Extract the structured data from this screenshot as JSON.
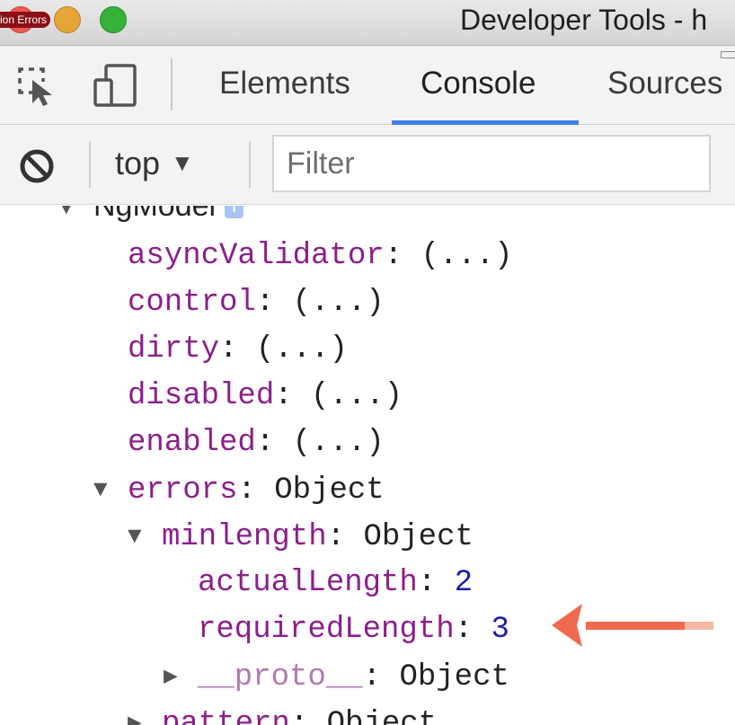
{
  "window": {
    "tab_label": "ion Errors",
    "title": "Developer Tools - h"
  },
  "toolbar": {
    "inspect_icon": "inspect-element-icon",
    "device_icon": "device-toolbar-icon",
    "tabs": [
      {
        "label": "Elements",
        "active": false
      },
      {
        "label": "Console",
        "active": true
      },
      {
        "label": "Sources",
        "active": false
      }
    ],
    "accent_color": "#3f80e6"
  },
  "filterbar": {
    "clear_icon": "clear-console-icon",
    "context": "top",
    "caret": "▼",
    "filter_placeholder": "Filter"
  },
  "tree": {
    "header": {
      "label": "NgModel",
      "badge": "i"
    },
    "props": [
      {
        "key": "asyncValidator",
        "value": "(...)"
      },
      {
        "key": "control",
        "value": "(...)"
      },
      {
        "key": "dirty",
        "value": "(...)"
      },
      {
        "key": "disabled",
        "value": "(...)"
      },
      {
        "key": "enabled",
        "value": "(...)"
      }
    ],
    "errors": {
      "key": "errors",
      "value": "Object"
    },
    "minlength": {
      "key": "minlength",
      "value": "Object"
    },
    "actualLength": {
      "key": "actualLength",
      "value": "2"
    },
    "requiredLength": {
      "key": "requiredLength",
      "value": "3"
    },
    "proto": {
      "key": "__proto__",
      "value": "Object"
    },
    "pattern": {
      "key": "pattern",
      "value": "Object"
    },
    "separator": ":",
    "expanded_glyph": "▼",
    "collapsed_glyph": "▶"
  },
  "annotation": {
    "arrow_color": "#ef6a4f",
    "arrow_icon": "left-arrow-icon"
  }
}
